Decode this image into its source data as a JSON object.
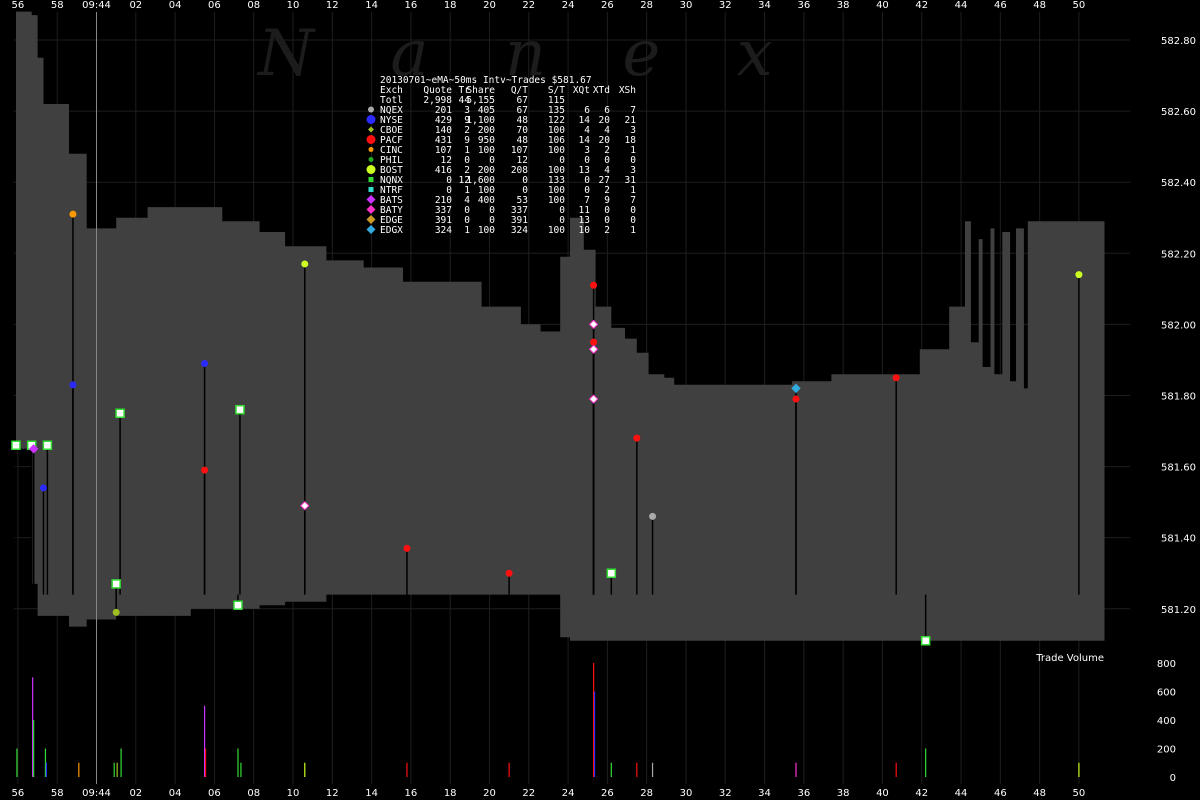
{
  "watermark": "N a n e x",
  "table": {
    "title": "20130701~eMA~50ms Intv~Trades $581.67",
    "header": [
      "Exch",
      "Quote",
      "Tr",
      "Share",
      "Q/T",
      "S/T",
      "XQt",
      "XTd",
      "XSh"
    ],
    "total": [
      "Totl",
      "2,998",
      "44",
      "5,155",
      "67",
      "115",
      "",
      "",
      ""
    ],
    "rows": [
      {
        "exch": "NQEX",
        "cells": [
          "201",
          "3",
          "405",
          "67",
          "135",
          "6",
          "6",
          "7"
        ],
        "color": "#aaaaaa",
        "shape": "circle"
      },
      {
        "exch": "NYSE",
        "cells": [
          "429",
          "9",
          "1,100",
          "48",
          "122",
          "14",
          "20",
          "21"
        ],
        "color": "#2b2bff",
        "shape": "circle-large"
      },
      {
        "exch": "CBOE",
        "cells": [
          "140",
          "2",
          "200",
          "70",
          "100",
          "4",
          "4",
          "3"
        ],
        "color": "#a0c020",
        "shape": "diamond-small"
      },
      {
        "exch": "PACF",
        "cells": [
          "431",
          "9",
          "950",
          "48",
          "106",
          "14",
          "20",
          "18"
        ],
        "color": "#ff1010",
        "shape": "circle-large"
      },
      {
        "exch": "CINC",
        "cells": [
          "107",
          "1",
          "100",
          "107",
          "100",
          "3",
          "2",
          "1"
        ],
        "color": "#ff9900",
        "shape": "circle-small"
      },
      {
        "exch": "PHIL",
        "cells": [
          "12",
          "0",
          "0",
          "12",
          "0",
          "0",
          "0",
          "0"
        ],
        "color": "#22aa22",
        "shape": "circle-small"
      },
      {
        "exch": "BOST",
        "cells": [
          "416",
          "2",
          "200",
          "208",
          "100",
          "13",
          "4",
          "3"
        ],
        "color": "#ccff22",
        "shape": "circle-large"
      },
      {
        "exch": "NQNX",
        "cells": [
          "0",
          "12",
          "1,600",
          "0",
          "133",
          "0",
          "27",
          "31"
        ],
        "color": "#33dd33",
        "shape": "square-small"
      },
      {
        "exch": "NTRF",
        "cells": [
          "0",
          "1",
          "100",
          "0",
          "100",
          "0",
          "2",
          "1"
        ],
        "color": "#33ddcc",
        "shape": "square-small"
      },
      {
        "exch": "BATS",
        "cells": [
          "210",
          "4",
          "400",
          "53",
          "100",
          "7",
          "9",
          "7"
        ],
        "color": "#cc33ff",
        "shape": "diamond"
      },
      {
        "exch": "BATY",
        "cells": [
          "337",
          "0",
          "0",
          "337",
          "0",
          "11",
          "0",
          "0"
        ],
        "color": "#ff33cc",
        "shape": "diamond"
      },
      {
        "exch": "EDGE",
        "cells": [
          "391",
          "0",
          "0",
          "391",
          "0",
          "13",
          "0",
          "0"
        ],
        "color": "#cc9922",
        "shape": "diamond"
      },
      {
        "exch": "EDGX",
        "cells": [
          "324",
          "1",
          "100",
          "324",
          "100",
          "10",
          "2",
          "1"
        ],
        "color": "#33aadd",
        "shape": "diamond"
      }
    ]
  },
  "chart_data": {
    "type": "area",
    "x_tick_labels": [
      "56",
      "58",
      "09:44",
      "02",
      "04",
      "06",
      "08",
      "10",
      "12",
      "14",
      "16",
      "18",
      "20",
      "22",
      "24",
      "26",
      "28",
      "30",
      "32",
      "34",
      "36",
      "38",
      "40",
      "42",
      "44",
      "46",
      "48",
      "50"
    ],
    "x_range_seconds": [
      55.8,
      112.6
    ],
    "price_axis": {
      "ticks": [
        "582.80",
        "582.60",
        "582.40",
        "582.20",
        "582.00",
        "581.80",
        "581.60",
        "581.40",
        "581.20"
      ],
      "ylim": [
        581.07,
        582.89
      ]
    },
    "volume_axis": {
      "label": "Trade Volume",
      "ticks": [
        "800",
        "600",
        "400",
        "200",
        "0"
      ],
      "ylim": [
        0,
        800
      ]
    },
    "time_marker_seconds": 60.0,
    "quote_band": {
      "times": [
        55.9,
        56.7,
        57.0,
        57.3,
        58.6,
        59.5,
        61.0,
        62.6,
        64.8,
        66.4,
        68.3,
        69.6,
        71.7,
        73.6,
        75.6,
        77.6,
        79.6,
        81.6,
        82.6,
        83.6,
        84.1,
        84.8,
        85.4,
        86.2,
        86.9,
        87.5,
        88.1,
        88.9,
        89.4,
        91.5,
        93.5,
        95.4,
        97.4,
        99.4,
        101.4,
        101.9,
        103.4,
        104.2,
        104.5,
        104.9,
        105.1,
        105.5,
        105.7,
        106.1,
        106.5,
        106.8,
        107.2,
        107.4,
        107.8,
        108.8,
        110.8,
        111.2
      ],
      "ask": [
        582.88,
        582.87,
        582.75,
        582.62,
        582.48,
        582.27,
        582.3,
        582.33,
        582.33,
        582.29,
        582.26,
        582.22,
        582.18,
        582.16,
        582.12,
        582.12,
        582.05,
        582.0,
        581.98,
        582.19,
        582.3,
        582.21,
        582.05,
        581.99,
        581.96,
        581.92,
        581.86,
        581.85,
        581.83,
        581.83,
        581.83,
        581.84,
        581.86,
        581.86,
        581.86,
        581.93,
        582.05,
        582.29,
        581.95,
        582.24,
        581.88,
        582.27,
        581.86,
        582.26,
        581.84,
        582.27,
        581.82,
        582.29,
        582.29,
        582.29,
        582.29,
        582.29
      ],
      "bid": [
        581.65,
        581.27,
        581.18,
        581.18,
        581.15,
        581.17,
        581.18,
        581.18,
        581.2,
        581.2,
        581.21,
        581.22,
        581.24,
        581.24,
        581.24,
        581.24,
        581.24,
        581.24,
        581.24,
        581.12,
        581.11,
        581.11,
        581.11,
        581.11,
        581.11,
        581.11,
        581.11,
        581.11,
        581.11,
        581.11,
        581.11,
        581.11,
        581.11,
        581.11,
        581.11,
        581.11,
        581.11,
        581.11,
        581.11,
        581.11,
        581.11,
        581.11,
        581.11,
        581.11,
        581.11,
        581.11,
        581.11,
        581.11,
        581.11,
        581.11,
        581.11,
        581.11
      ]
    },
    "trades": [
      {
        "t": 55.9,
        "price": 581.66,
        "exch": "NQNX"
      },
      {
        "t": 56.7,
        "price": 581.66,
        "exch": "NQNX"
      },
      {
        "t": 56.8,
        "price": 581.65,
        "exch": "BATS"
      },
      {
        "t": 57.3,
        "price": 581.54,
        "exch": "NYSE"
      },
      {
        "t": 57.5,
        "price": 581.66,
        "exch": "NQNX"
      },
      {
        "t": 58.8,
        "price": 582.31,
        "exch": "CINC"
      },
      {
        "t": 58.8,
        "price": 581.83,
        "exch": "NYSE"
      },
      {
        "t": 61.0,
        "price": 581.27,
        "exch": "NQNX"
      },
      {
        "t": 61.0,
        "price": 581.19,
        "exch": "CBOE"
      },
      {
        "t": 61.2,
        "price": 581.75,
        "exch": "NQNX"
      },
      {
        "t": 65.5,
        "price": 581.89,
        "exch": "NYSE"
      },
      {
        "t": 65.5,
        "price": 581.59,
        "exch": "PACF"
      },
      {
        "t": 67.2,
        "price": 581.21,
        "exch": "NQNX"
      },
      {
        "t": 67.3,
        "price": 581.76,
        "exch": "NQNX"
      },
      {
        "t": 70.6,
        "price": 582.17,
        "exch": "BOST"
      },
      {
        "t": 70.6,
        "price": 581.49,
        "exch": "BATY"
      },
      {
        "t": 75.8,
        "price": 581.37,
        "exch": "PACF"
      },
      {
        "t": 81.0,
        "price": 581.3,
        "exch": "PACF"
      },
      {
        "t": 85.3,
        "price": 582.11,
        "exch": "PACF"
      },
      {
        "t": 85.3,
        "price": 581.95,
        "exch": "PACF"
      },
      {
        "t": 85.3,
        "price": 582.0,
        "exch": "BATY"
      },
      {
        "t": 85.3,
        "price": 581.93,
        "exch": "BATY"
      },
      {
        "t": 85.3,
        "price": 581.79,
        "exch": "BATY"
      },
      {
        "t": 86.2,
        "price": 581.3,
        "exch": "NQNX"
      },
      {
        "t": 87.5,
        "price": 581.68,
        "exch": "PACF"
      },
      {
        "t": 88.3,
        "price": 581.46,
        "exch": "NQEX"
      },
      {
        "t": 95.6,
        "price": 581.82,
        "exch": "EDGX"
      },
      {
        "t": 95.6,
        "price": 581.79,
        "exch": "PACF"
      },
      {
        "t": 100.7,
        "price": 581.85,
        "exch": "PACF"
      },
      {
        "t": 102.2,
        "price": 581.11,
        "exch": "NQNX"
      },
      {
        "t": 110.0,
        "price": 582.14,
        "exch": "BOST"
      }
    ],
    "volume_bars": [
      {
        "t": 55.95,
        "v": 200,
        "exch": "NQNX"
      },
      {
        "t": 56.75,
        "v": 700,
        "exch": "BATS"
      },
      {
        "t": 56.8,
        "v": 400,
        "exch": "NQNX"
      },
      {
        "t": 57.4,
        "v": 200,
        "exch": "NQNX"
      },
      {
        "t": 57.45,
        "v": 100,
        "exch": "NYSE"
      },
      {
        "t": 59.1,
        "v": 100,
        "exch": "CINC"
      },
      {
        "t": 60.9,
        "v": 100,
        "exch": "NQNX"
      },
      {
        "t": 61.05,
        "v": 100,
        "exch": "CBOE"
      },
      {
        "t": 61.25,
        "v": 200,
        "exch": "NQNX"
      },
      {
        "t": 65.5,
        "v": 500,
        "exch": "BATS"
      },
      {
        "t": 65.55,
        "v": 200,
        "exch": "PACF"
      },
      {
        "t": 67.2,
        "v": 200,
        "exch": "NQNX"
      },
      {
        "t": 67.35,
        "v": 100,
        "exch": "NQNX"
      },
      {
        "t": 70.6,
        "v": 100,
        "exch": "BOST"
      },
      {
        "t": 75.8,
        "v": 100,
        "exch": "PACF"
      },
      {
        "t": 81.0,
        "v": 100,
        "exch": "PACF"
      },
      {
        "t": 85.3,
        "v": 800,
        "exch": "PACF"
      },
      {
        "t": 85.35,
        "v": 600,
        "exch": "NYSE"
      },
      {
        "t": 86.2,
        "v": 100,
        "exch": "NQNX"
      },
      {
        "t": 87.5,
        "v": 100,
        "exch": "PACF"
      },
      {
        "t": 88.3,
        "v": 100,
        "exch": "NQEX"
      },
      {
        "t": 95.6,
        "v": 100,
        "exch": "BATY"
      },
      {
        "t": 100.7,
        "v": 100,
        "exch": "PACF"
      },
      {
        "t": 102.2,
        "v": 200,
        "exch": "NQNX"
      },
      {
        "t": 110.0,
        "v": 100,
        "exch": "BOST"
      }
    ]
  }
}
